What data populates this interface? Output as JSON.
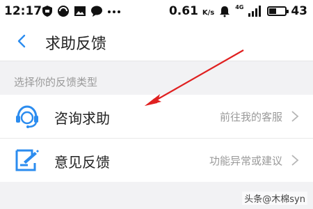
{
  "status_bar": {
    "time": "12:17",
    "left_icons": [
      "shield-icon",
      "circle-icon",
      "image-icon",
      "chat-icon",
      "more-icon"
    ],
    "speed": "0.61",
    "speed_unit": "K/s",
    "network": "4G",
    "battery_level": "43"
  },
  "header": {
    "title": "求助反馈"
  },
  "section": {
    "label": "选择你的反馈类型"
  },
  "items": [
    {
      "label": "咨询求助",
      "hint": "前往我的客服",
      "icon": "headset-agent-icon"
    },
    {
      "label": "意见反馈",
      "hint": "功能异常或建议",
      "icon": "edit-note-icon"
    }
  ],
  "colors": {
    "accent": "#2b8cef",
    "arrow": "#e02020",
    "background": "#f2f2f4"
  },
  "watermark": "头条@木棉syn"
}
